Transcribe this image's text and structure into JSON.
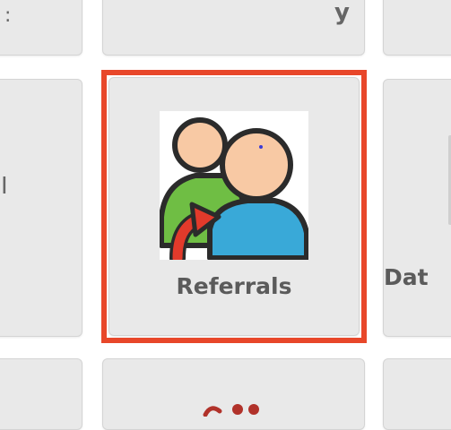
{
  "tiles": {
    "left_middle": {
      "label": "I"
    },
    "referrals": {
      "label": "Referrals",
      "icon": "referrals-users-arrow-icon"
    },
    "right_middle": {
      "label": "Dat"
    },
    "top_left": {
      "label": ":"
    },
    "top_middle": {
      "label": "y"
    }
  },
  "colors": {
    "tile_bg": "#e9e9e9",
    "highlight": "#e8472a",
    "label_text": "#5b5b5b"
  }
}
